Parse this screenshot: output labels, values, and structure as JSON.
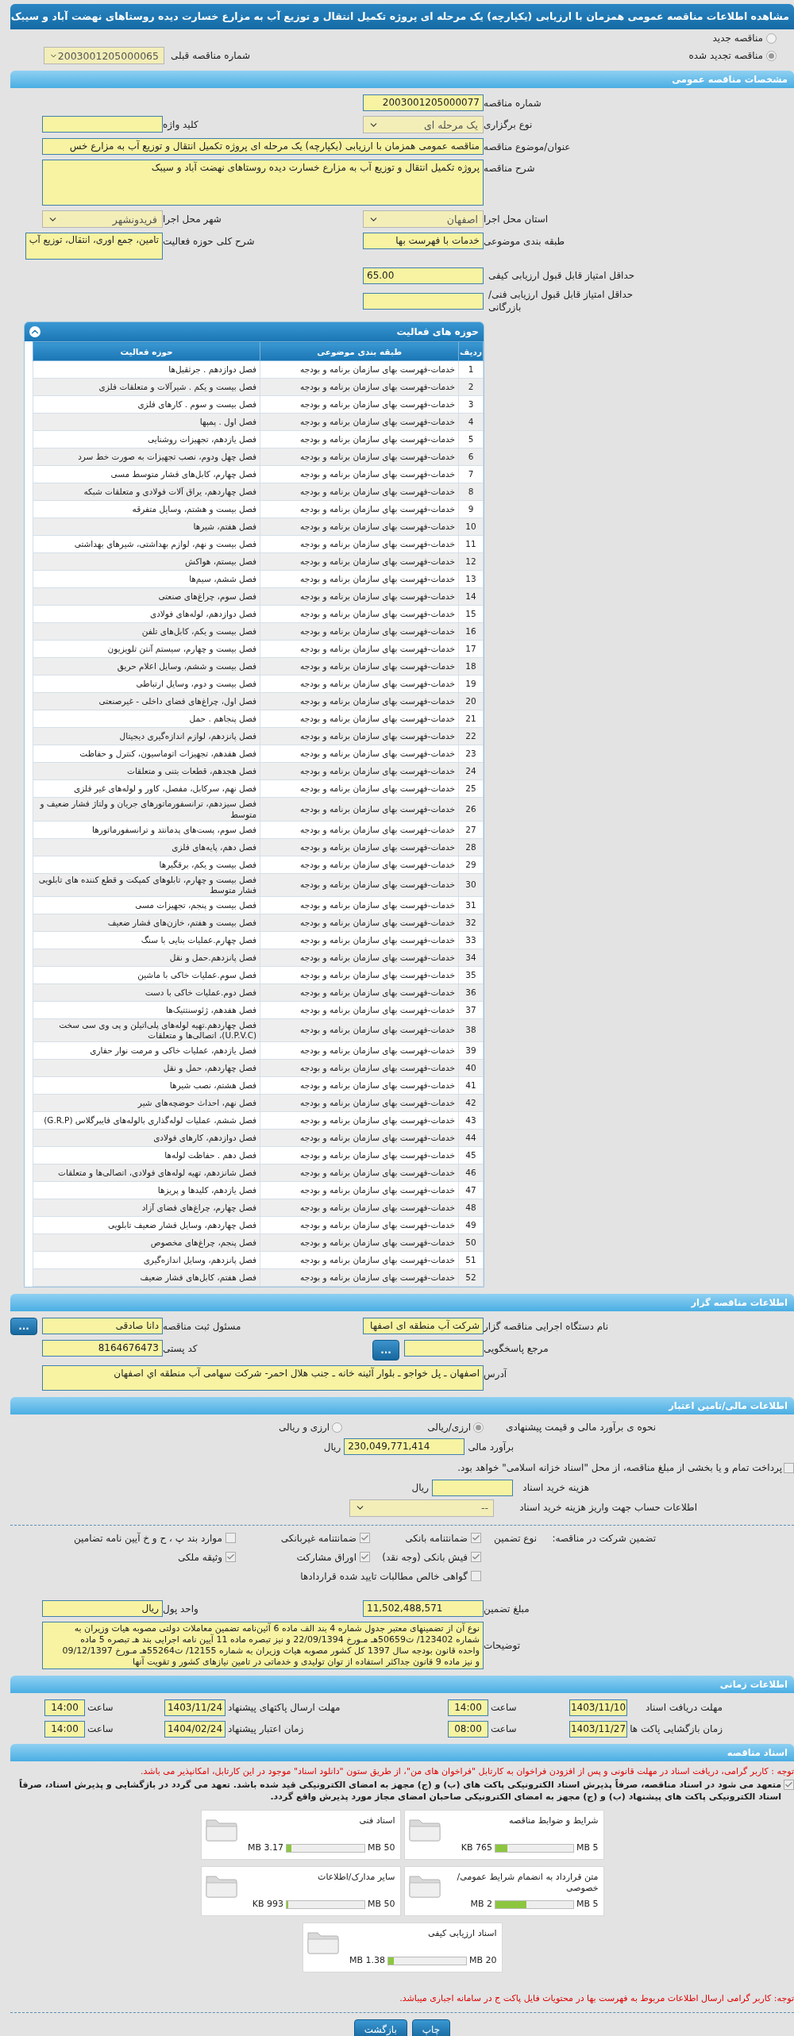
{
  "page_title": "مشاهده اطلاعات مناقصه عمومی همزمان با ارزیابی (یکپارچه) یک مرحله ای پروژه تکمیل انتقال و توزیع آب به مزارع خسارت دیده روستاهای نهضت آباد و سیبک",
  "tender_type": [
    {
      "label": "مناقصه جدید",
      "selected": false
    },
    {
      "label": "مناقصه تجدید شده",
      "selected": true
    }
  ],
  "previous_tender": {
    "label": "شماره مناقصه قبلی",
    "value": "2003001205000065"
  },
  "general": {
    "title": "مشخصات مناقصه عمومی",
    "rows": [
      [
        {
          "kind": "text",
          "label": "شماره مناقصه",
          "value": "2003001205000077"
        }
      ],
      [
        {
          "kind": "select",
          "label": "نوع برگزاری",
          "value": "یک مرحله ای"
        },
        {
          "kind": "text",
          "label": "کلید واژه"
        }
      ],
      [
        {
          "kind": "wide",
          "label": "عنوان/موضوع مناقصه",
          "value": "مناقصه عمومی همزمان با ارزیابی (یکپارچه) یک مرحله ای پروژه تکمیل انتقال و توزیع آب به مزارع خس"
        }
      ],
      [
        {
          "kind": "area",
          "label": "شرح مناقصه",
          "value": "پروژه تکمیل انتقال و توزیع آب به مزارع خسارت دیده روستاهای نهضت آباد و سیبک"
        }
      ],
      [
        {
          "kind": "select",
          "label": "استان محل اجرا",
          "value": "اصفهان"
        },
        {
          "kind": "select",
          "label": "شهر محل اجرا",
          "value": "فریدونشهر"
        }
      ],
      [
        {
          "kind": "text",
          "label": "طبقه بندی موضوعی",
          "value": "خدمات با فهرست بها"
        },
        {
          "kind": "note",
          "label": "شرح کلی حوزه فعالیت",
          "value": "تامین، جمع اوری، انتقال، توزیع آب"
        }
      ]
    ],
    "scores": [
      {
        "label": "حداقل امتیاز قابل قبول ارزیابی کیفی",
        "value": "65.00"
      },
      {
        "label": "حداقل امتیاز قابل قبول ارزیابی فنی/بازرگانی"
      }
    ]
  },
  "activities": {
    "title": "حوزه های فعالیت",
    "expanded": true,
    "columns": [
      "ردیف",
      "طبقه بندی موضوعی",
      "حوزه فعالیت"
    ],
    "rows": [
      [
        "1",
        "خدمات-فهرست بهای سازمان برنامه و بودجه",
        "فصل دوازدهم . جرثقیل‌ها"
      ],
      [
        "2",
        "خدمات-فهرست بهای سازمان برنامه و بودجه",
        "فصل بیست و یکم . شیرآلات و متعلقات فلزی"
      ],
      [
        "3",
        "خدمات-فهرست بهای سازمان برنامه و بودجه",
        "فصل بیست و سوم . کارهای فلزی"
      ],
      [
        "4",
        "خدمات-فهرست بهای سازمان برنامه و بودجه",
        "فصل اول . پمپها"
      ],
      [
        "5",
        "خدمات-فهرست بهای سازمان برنامه و بودجه",
        "فصل یازدهم، تجهیزات روشنایی"
      ],
      [
        "6",
        "خدمات-فهرست بهای سازمان برنامه و بودجه",
        "فصل چهل ودوم، نصب تجهیزات به صورت خط سرد"
      ],
      [
        "7",
        "خدمات-فهرست بهای سازمان برنامه و بودجه",
        "فصل چهارم، کابل‌های فشار متوسط مسی"
      ],
      [
        "8",
        "خدمات-فهرست بهای سازمان برنامه و بودجه",
        "فصل چهاردهم، یراق آلات فولادی و متعلقات شبکه"
      ],
      [
        "9",
        "خدمات-فهرست بهای سازمان برنامه و بودجه",
        "فصل بیست و هشتم، وسایل متفرقه"
      ],
      [
        "10",
        "خدمات-فهرست بهای سازمان برنامه و بودجه",
        "فصل هفتم، شیرها"
      ],
      [
        "11",
        "خدمات-فهرست بهای سازمان برنامه و بودجه",
        "فصل بیست و نهم، لوازم بهداشتی، شیرهای بهداشتی"
      ],
      [
        "12",
        "خدمات-فهرست بهای سازمان برنامه و بودجه",
        "فصل بیستم، هواکش"
      ],
      [
        "13",
        "خدمات-فهرست بهای سازمان برنامه و بودجه",
        "فصل ششم، سیم‌ها"
      ],
      [
        "14",
        "خدمات-فهرست بهای سازمان برنامه و بودجه",
        "فصل سوم، چراغ‌های صنعتی"
      ],
      [
        "15",
        "خدمات-فهرست بهای سازمان برنامه و بودجه",
        "فصل دوازدهم، لوله‌های فولادی"
      ],
      [
        "16",
        "خدمات-فهرست بهای سازمان برنامه و بودجه",
        "فصل بیست و یکم، کابل‌های تلفن"
      ],
      [
        "17",
        "خدمات-فهرست بهای سازمان برنامه و بودجه",
        "فصل بیست و چهارم، سیستم آنتن تلویزیون"
      ],
      [
        "18",
        "خدمات-فهرست بهای سازمان برنامه و بودجه",
        "فصل بیست و ششم، وسایل اعلام حریق"
      ],
      [
        "19",
        "خدمات-فهرست بهای سازمان برنامه و بودجه",
        "فصل بیست و دوم، وسایل ارتباطی"
      ],
      [
        "20",
        "خدمات-فهرست بهای سازمان برنامه و بودجه",
        "فصل اول، چراغ‌های فضای داخلی - غیرصنعتی"
      ],
      [
        "21",
        "خدمات-فهرست بهای سازمان برنامه و بودجه",
        "فصل پنجاهم . حمل"
      ],
      [
        "22",
        "خدمات-فهرست بهای سازمان برنامه و بودجه",
        "فصل پانزدهم، لوازم اندازه‌گیری دیجیتال"
      ],
      [
        "23",
        "خدمات-فهرست بهای سازمان برنامه و بودجه",
        "فصل هفدهم، تجهیزات اتوماسیون، کنترل و حفاظت"
      ],
      [
        "24",
        "خدمات-فهرست بهای سازمان برنامه و بودجه",
        "فصل هجدهم، قطعات بتنی و متعلقات"
      ],
      [
        "25",
        "خدمات-فهرست بهای سازمان برنامه و بودجه",
        "فصل نهم، سرکابل، مفصل، کاور و لوله‌های غیر فلزی"
      ],
      [
        "26",
        "خدمات-فهرست بهای سازمان برنامه و بودجه",
        "فصل سیزدهم، ترانسفورماتورهای جریان و ولتاژ فشار ضعیف و متوسط"
      ],
      [
        "27",
        "خدمات-فهرست بهای سازمان برنامه و بودجه",
        "فصل سوم، پست‌های پدمانتد و ترانسفورماتورها"
      ],
      [
        "28",
        "خدمات-فهرست بهای سازمان برنامه و بودجه",
        "فصل دهم، پایه‌های فلزی"
      ],
      [
        "29",
        "خدمات-فهرست بهای سازمان برنامه و بودجه",
        "فصل بیست و یکم، برقگیرها"
      ],
      [
        "30",
        "خدمات-فهرست بهای سازمان برنامه و بودجه",
        "فصل بیست و چهارم، تابلوهای کمپکت و قطع کننده های تابلویی فشار متوسط"
      ],
      [
        "31",
        "خدمات-فهرست بهای سازمان برنامه و بودجه",
        "فصل بیست و پنجم، تجهیزات مسی"
      ],
      [
        "32",
        "خدمات-فهرست بهای سازمان برنامه و بودجه",
        "فصل بیست و هفتم، خازن‌های فشار ضعیف"
      ],
      [
        "33",
        "خدمات-فهرست بهای سازمان برنامه و بودجه",
        "فصل چهارم.عملیات بنایی با سنگ"
      ],
      [
        "34",
        "خدمات-فهرست بهای سازمان برنامه و بودجه",
        "فصل پانزدهم.حمل و نقل"
      ],
      [
        "35",
        "خدمات-فهرست بهای سازمان برنامه و بودجه",
        "فصل سوم.عملیات خاکی با ماشین"
      ],
      [
        "36",
        "خدمات-فهرست بهای سازمان برنامه و بودجه",
        "فصل دوم.عملیات خاکی با دست"
      ],
      [
        "37",
        "خدمات-فهرست بهای سازمان برنامه و بودجه",
        "فصل هفدهم، ژئوسنتتیک‌ها"
      ],
      [
        "38",
        "خدمات-فهرست بهای سازمان برنامه و بودجه",
        "فصل چهاردهم.تهیه لوله‌های پلی‌اتیلن و پی وی سی سخت (U.P.V.C)، اتصالی‌ها و متعلقات"
      ],
      [
        "39",
        "خدمات-فهرست بهای سازمان برنامه و بودجه",
        "فصل یازدهم، عملیات خاکی و مرمت نوار حفاری"
      ],
      [
        "40",
        "خدمات-فهرست بهای سازمان برنامه و بودجه",
        "فصل چهاردهم، حمل و نقل"
      ],
      [
        "41",
        "خدمات-فهرست بهای سازمان برنامه و بودجه",
        "فصل هشتم، نصب شیرها"
      ],
      [
        "42",
        "خدمات-فهرست بهای سازمان برنامه و بودجه",
        "فصل نهم، احداث حوضچه‌های شیر"
      ],
      [
        "43",
        "خدمات-فهرست بهای سازمان برنامه و بودجه",
        "فصل ششم، عملیات لوله‌گذاری بالوله‌های فایبرگلاس (G.R.P)"
      ],
      [
        "44",
        "خدمات-فهرست بهای سازمان برنامه و بودجه",
        "فصل دوازدهم، کارهای فولادی"
      ],
      [
        "45",
        "خدمات-فهرست بهای سازمان برنامه و بودجه",
        "فصل دهم . حفاظت لوله‌ها"
      ],
      [
        "46",
        "خدمات-فهرست بهای سازمان برنامه و بودجه",
        "فصل شانزدهم، تهیه لوله‌های فولادی، اتصالی‌ها و متعلقات"
      ],
      [
        "47",
        "خدمات-فهرست بهای سازمان برنامه و بودجه",
        "فصل یازدهم، کلیدها و پریزها"
      ],
      [
        "48",
        "خدمات-فهرست بهای سازمان برنامه و بودجه",
        "فصل چهارم، چراغ‌های فضای آزاد"
      ],
      [
        "49",
        "خدمات-فهرست بهای سازمان برنامه و بودجه",
        "فصل چهاردهم، وسایل فشار ضعیف تابلویی"
      ],
      [
        "50",
        "خدمات-فهرست بهای سازمان برنامه و بودجه",
        "فصل پنجم، چراغ‌های مخصوص"
      ],
      [
        "51",
        "خدمات-فهرست بهای سازمان برنامه و بودجه",
        "فصل پانزدهم، وسایل اندازه‌گیری"
      ],
      [
        "52",
        "خدمات-فهرست بهای سازمان برنامه و بودجه",
        "فصل هفتم، کابل‌های فشار ضعیف"
      ]
    ]
  },
  "contractor": {
    "title": "اطلاعات مناقصه گزار",
    "rows": [
      [
        {
          "kind": "text",
          "label": "نام دستگاه اجرایی مناقصه گزار",
          "value": "شرکت آب منطقه ای اصفها"
        },
        {
          "kind": "text_button",
          "label": "مسئول ثبت مناقصه",
          "value": "دانا صادقی",
          "button": "..."
        }
      ],
      [
        {
          "kind": "short_button",
          "label": "مرجع پاسخگویی",
          "button": "..."
        },
        {
          "kind": "text",
          "label": "کد پستی",
          "value": "8164676473"
        }
      ],
      [
        {
          "kind": "area",
          "label": "آدرس",
          "value": "اصفهان ـ پل خواجو ـ بلوار آئینه خانه ـ جنب هلال احمر- شرکت سهامی آب منطقه اي اصفهان"
        }
      ]
    ]
  },
  "finance": {
    "title": "اطلاعات مالی/تامین اعتبار",
    "estimate_method": {
      "label": "نحوه ی برآورد مالی و قیمت پیشنهادی",
      "options": [
        {
          "label": "ارزی/ریالی",
          "selected": true
        },
        {
          "label": "ارزی و ریالی",
          "selected": false
        }
      ]
    },
    "estimate": {
      "label": "برآورد مالی",
      "value": "230,049,771,414",
      "unit": "ریال"
    },
    "treasury": {
      "label": "پرداخت تمام و یا بخشی از مبلغ مناقصه، از محل \"اسناد خزانه اسلامی\" خواهد بود.",
      "checked": false
    },
    "doc_fee": {
      "label": "هزینه خرید اسناد",
      "unit": "ریال"
    },
    "account": {
      "label": "اطلاعات حساب جهت واریز هزینه خرید اسناد",
      "value": "--"
    },
    "guarantee": {
      "label": "تضمین شرکت در مناقصه:",
      "type_label": "نوع تضمین",
      "options": [
        {
          "label": "ضمانتنامه بانکی",
          "checked": true
        },
        {
          "label": "ضمانتنامه غیربانکی",
          "checked": true
        },
        {
          "label": "موارد بند پ ، ح و خ آیین نامه تضامین",
          "checked": false
        },
        {
          "label": "فیش بانکی (وجه نقد)",
          "checked": true
        },
        {
          "label": "اوراق مشارکت",
          "checked": true
        },
        {
          "label": "وثیقه ملکی",
          "checked": true
        },
        {
          "label": "گواهی خالص مطالبات تایید شده قراردادها",
          "checked": false
        }
      ]
    },
    "amount": {
      "label": "مبلغ تضمین",
      "value": "11,502,488,571"
    },
    "currency": {
      "label": "واحد پول",
      "value": "ریال"
    },
    "notes": {
      "label": "توضیحات",
      "value": "نوع آن از تضمینهای معتبر جدول شماره 4 بند الف ماده 6 آئین‌نامه تضمین معاملات دولتی مصوبه هیات وزیران به شماره 123402/ ت50659هـ مـورخ 22/09/1394 و نیز تبصره ماده 11 آیین نامه اجرایی بند هـ تبصره 5 ماده واحده قانون بودجه سال 1397 کل کشور مصوبه هیات وزیران به شماره 12155/ ت55264هـ مـورخ 09/12/1397 و نیز ماده 9 قانون جداکثر استفاده از توان تولیدی و خدماتی در تامین نیازهای کشور و تقویت آنها"
    }
  },
  "timing": {
    "title": "اطلاعات زمانی",
    "rows": [
      [
        {
          "label": "مهلت دریافت اسناد",
          "value": "1403/11/10"
        },
        {
          "label": "ساعت",
          "value": "14:00"
        },
        {
          "label": "مهلت ارسال پاکتهای پیشنهاد",
          "value": "1403/11/24"
        },
        {
          "label": "ساعت",
          "value": "14:00"
        }
      ],
      [
        {
          "label": "زمان بازگشایی پاکت ها",
          "value": "1403/11/27"
        },
        {
          "label": "ساعت",
          "value": "08:00"
        },
        {
          "label": "زمان اعتبار پیشنهاد",
          "value": "1404/02/24"
        },
        {
          "label": "ساعت",
          "value": "14:00"
        }
      ]
    ]
  },
  "documents": {
    "title": "اسناد مناقصه",
    "notice": "توجه : کاربر گرامی، دریافت اسناد در مهلت قانونی و پس از افزودن فراخوان به کارتابل \"فراخوان های من\"، از طریق ستون \"دانلود اسناد\" موجود در این کارتابل، امکانپذیر می باشد.",
    "commitment": {
      "text": "متعهد می شود در اسناد مناقصه، صرفاً پذیرش اسناد الکترونیکی پاکت های (ب) و (ج) مجهز به امضای الکترونیکی قید شده باشد. تعهد می گردد در بازگشایی و پذیرش اسناد، صرفاً اسناد الکترونیکی پاکت های پیشنهاد (ب) و (ج) مجهز به امضای الکترونیکی صاحبان امضای مجاز مورد پذیرش واقع گردد.",
      "checked": true
    },
    "files": [
      {
        "name": "شرایط و ضوابط مناقصه",
        "size": "765 KB",
        "max": "5 MB",
        "level": 0.15
      },
      {
        "name": "اسناد فنی",
        "size": "3.17 MB",
        "max": "50 MB",
        "level": 0.063
      },
      {
        "name": "متن قرارداد به انضمام شرایط عمومی/خصوصی",
        "size": "2 MB",
        "max": "5 MB",
        "level": 0.4
      },
      {
        "name": "سایر مدارک/اطلاعات",
        "size": "993 KB",
        "max": "50 MB",
        "level": 0.02
      },
      {
        "name": "اسناد ارزیابی کیفی",
        "size": "1.38 MB",
        "max": "20 MB",
        "level": 0.069
      }
    ],
    "footer_note": "توجه: کاربر گرامی ارسال اطلاعات مربوط به فهرست بها در محتویات فایل پاکت ج در سامانه اجباری میباشد."
  },
  "buttons": [
    "چاپ",
    "بازگشت"
  ]
}
